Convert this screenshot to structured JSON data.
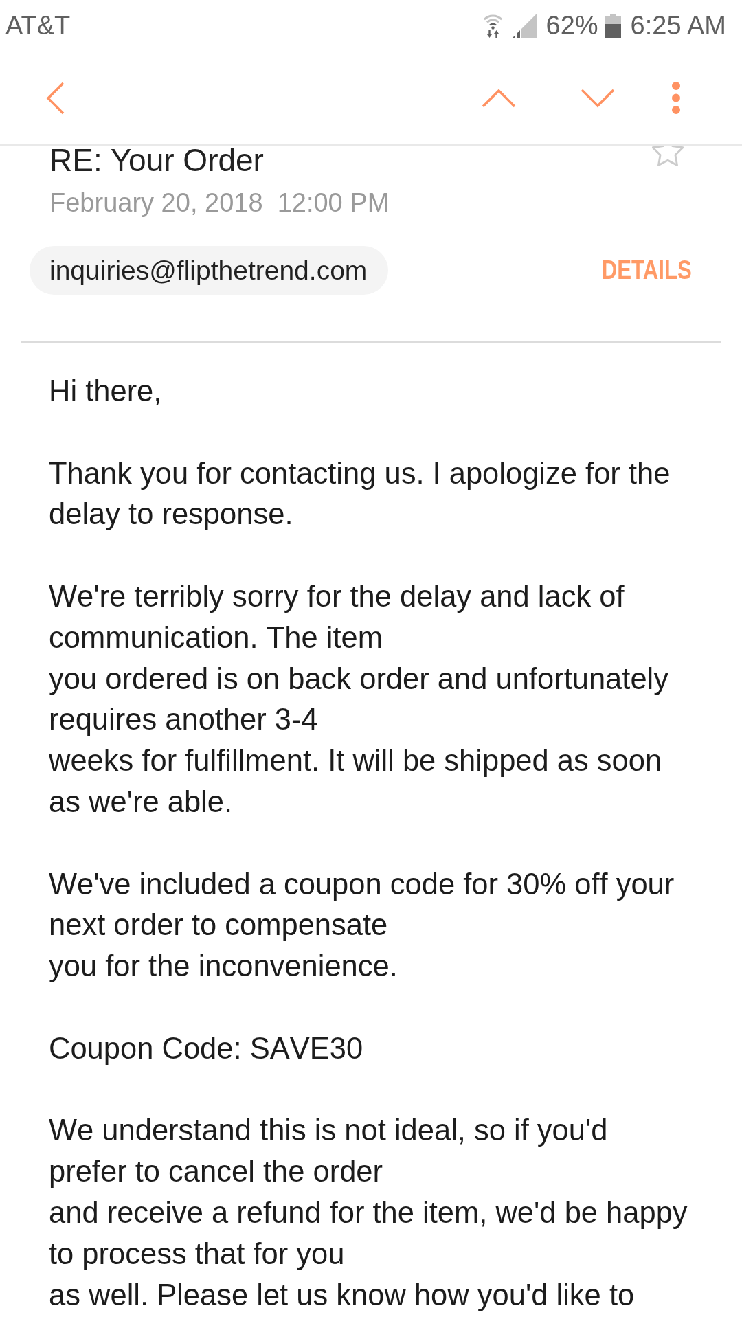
{
  "status_bar": {
    "carrier": "AT&T",
    "battery_percent": "62%",
    "time": "6:25 AM"
  },
  "toolbar": {
    "buttons": [
      {
        "kind": "back"
      },
      {
        "kind": "previous"
      },
      {
        "kind": "next"
      },
      {
        "kind": "more"
      }
    ]
  },
  "email": {
    "subject": "RE: Your Order",
    "starred": false,
    "date": "February 20, 2018  12:00 PM",
    "sender": "inquiries@flipthetrend.com",
    "details_label": "DETAILS",
    "body": [
      "Hi there,",
      "Thank you for contacting us. I apologize for the delay to response.",
      "We're terribly sorry for the delay and lack of communication. The item\nyou ordered is on back order and unfortunately requires another 3-4\nweeks for fulfillment. It will be shipped as soon as we're able.",
      "We've included a coupon code for 30% off your next order to compensate\nyou for the inconvenience.",
      "Coupon Code: SAVE30",
      "We understand this is not ideal, so if you'd prefer to cancel the order\nand receive a refund for the item, we'd be happy to process that for you\nas well. Please let us know how you'd like to"
    ]
  }
}
